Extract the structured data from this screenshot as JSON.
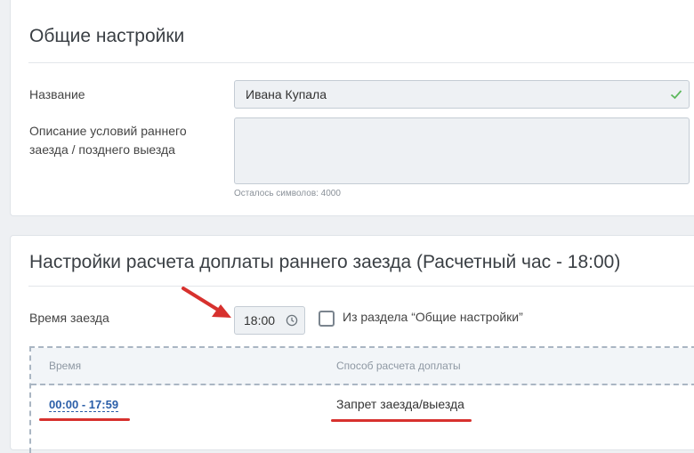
{
  "general": {
    "title": "Общие настройки",
    "name_label": "Название",
    "name_value": "Ивана Купала",
    "desc_label_line1": "Описание условий раннего",
    "desc_label_line2": "заезда / позднего выезда",
    "desc_value": "",
    "chars_left": "Осталось символов: 4000"
  },
  "early": {
    "title": "Настройки расчета доплаты раннего заезда (Расчетный час - 18:00)",
    "time_label": "Время заезда",
    "time_value": "18:00",
    "checkbox_label": "Из раздела “Общие настройки”",
    "checkbox_checked": false,
    "table": {
      "headers": [
        "Время",
        "Способ расчета доплаты"
      ],
      "rows": [
        {
          "time": "00:00 - 17:59",
          "method": "Запрет заезда/выезда"
        }
      ]
    }
  },
  "colors": {
    "accent_link": "#2a5ea8",
    "annotation_red": "#d7312e",
    "valid_check": "#5cb85c"
  }
}
